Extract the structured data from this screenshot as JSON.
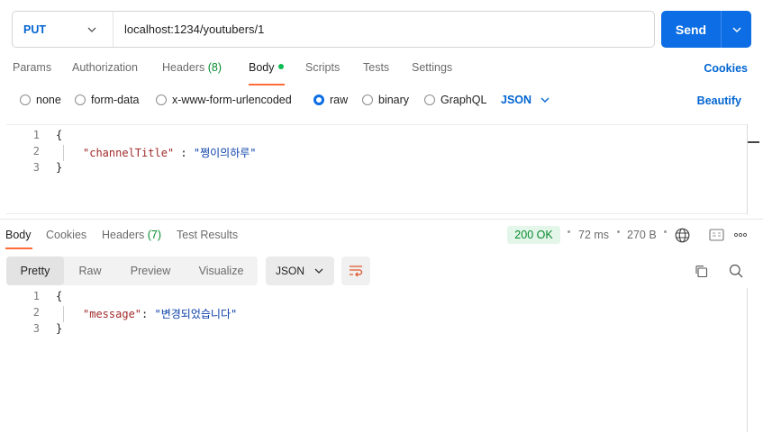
{
  "request": {
    "method": "PUT",
    "url": "localhost:1234/youtubers/1",
    "send_label": "Send"
  },
  "tabs": [
    {
      "label": "Params"
    },
    {
      "label": "Authorization"
    },
    {
      "label": "Headers",
      "count": "(8)"
    },
    {
      "label": "Body"
    },
    {
      "label": "Scripts"
    },
    {
      "label": "Tests"
    },
    {
      "label": "Settings"
    }
  ],
  "cookies_label": "Cookies",
  "body_types": [
    "none",
    "form-data",
    "x-www-form-urlencoded",
    "raw",
    "binary",
    "GraphQL"
  ],
  "selected_body_type": "raw",
  "body_language": "JSON",
  "beautify_label": "Beautify",
  "request_body": {
    "line_numbers": [
      "1",
      "2",
      "3"
    ],
    "open_brace": "{",
    "key": "\"channelTitle\"",
    "colon": " : ",
    "value": "\"쩡이의하루\"",
    "close_brace": "}"
  },
  "response": {
    "tabs": [
      {
        "label": "Body"
      },
      {
        "label": "Cookies"
      },
      {
        "label": "Headers",
        "count": "(7)"
      },
      {
        "label": "Test Results"
      }
    ],
    "status": "200 OK",
    "time": "72 ms",
    "size": "270 B",
    "view_modes": [
      "Pretty",
      "Raw",
      "Preview",
      "Visualize"
    ],
    "format": "JSON",
    "body": {
      "line_numbers": [
        "1",
        "2",
        "3"
      ],
      "open_brace": "{",
      "key": "\"message\"",
      "colon": ": ",
      "value": "\"변경되었습니다\"",
      "close_brace": "}"
    }
  },
  "colors": {
    "accent_blue": "#0c6de4",
    "link_blue": "#0265d2",
    "active_tab_underline": "#ff6c37",
    "status_green": "#078a2e"
  }
}
